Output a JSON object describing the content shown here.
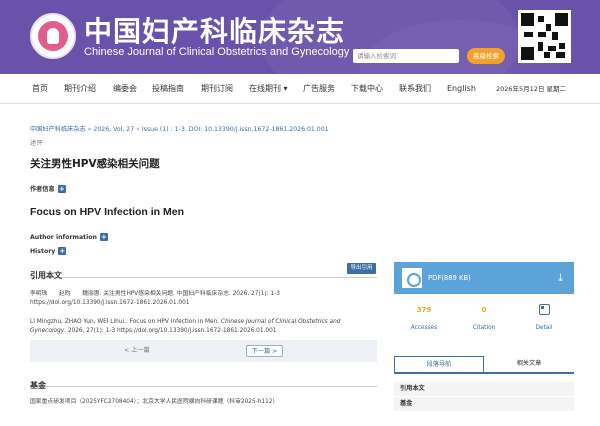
{
  "header": {
    "title_cn": "中国妇产科临床杂志",
    "title_en": "Chinese Journal of Clinical Obstetrics and Gynecology",
    "search_placeholder": "请输入检索词",
    "advanced_search": "高级检索"
  },
  "nav": {
    "items": [
      "首页",
      "期刊介绍",
      "编委会",
      "投稿指南",
      "期刊订阅",
      "在线期刊 ▾",
      "广告服务",
      "下载中心",
      "联系我们",
      "English"
    ],
    "date": "2026年5月12日 星期二"
  },
  "breadcrumb": {
    "journal": "中国妇产科临床杂志",
    "year_vol": "2026, Vol. 27",
    "issue": "Issue (1) : 1-3.",
    "doi": "DOI: 10.13390/j.issn.1672-1861.2026.01.001"
  },
  "article": {
    "reviews_label": "述评",
    "title_cn": "关注男性HPV感染相关问题",
    "author_info_cn": "作者信息",
    "title_en": "Focus on HPV Infection in Men",
    "author_info_en": "Author information",
    "history": "History"
  },
  "citation": {
    "heading": "引用本文",
    "export": "导出引用",
    "cn_authors": "李明珠　　赵昀　　魏丽惠",
    "cn_rest": ". 关注男性HPV感染相关问题. 中国妇产科临床杂志. 2026, 27(1): 1-3",
    "cn_doi": "https://doi.org/10.13390/j.issn.1672-1861.2026.01.001",
    "en_pre": "LI Mingzhu, ZHAO Yun, WEI Lihui.. Focus on HPV Infection in Men. ",
    "en_journal": "Chinese Journal of Clinical Obstetrics and Gynecology",
    "en_rest": ". 2026, 27(1): 1-3 https://doi.org/10.13390/j.issn.1672-1861.2026.01.001",
    "prev": "< 上一篇",
    "next": "下一篇 >"
  },
  "funding": {
    "heading": "基金",
    "text": "国家重点研发项目（2025YFC2708404）；北京大学人民医院横向科研课题（科审2025-h112）"
  },
  "sidebar": {
    "pdf_label": "PDF(889 KB)",
    "accesses_value": "379",
    "accesses_label": "Accesses",
    "citation_value": "0",
    "citation_label": "Citation",
    "detail_label": "Detail",
    "tab_nav": "段落导航",
    "tab_related": "相关文章",
    "section_cite": "引用本文",
    "section_fund": "基金"
  },
  "colors": {
    "header_bg": "#6a51a9",
    "accent_blue": "#3a6ea5",
    "accent_orange": "#f2a12d",
    "pdf_box": "#5ba3d9"
  }
}
